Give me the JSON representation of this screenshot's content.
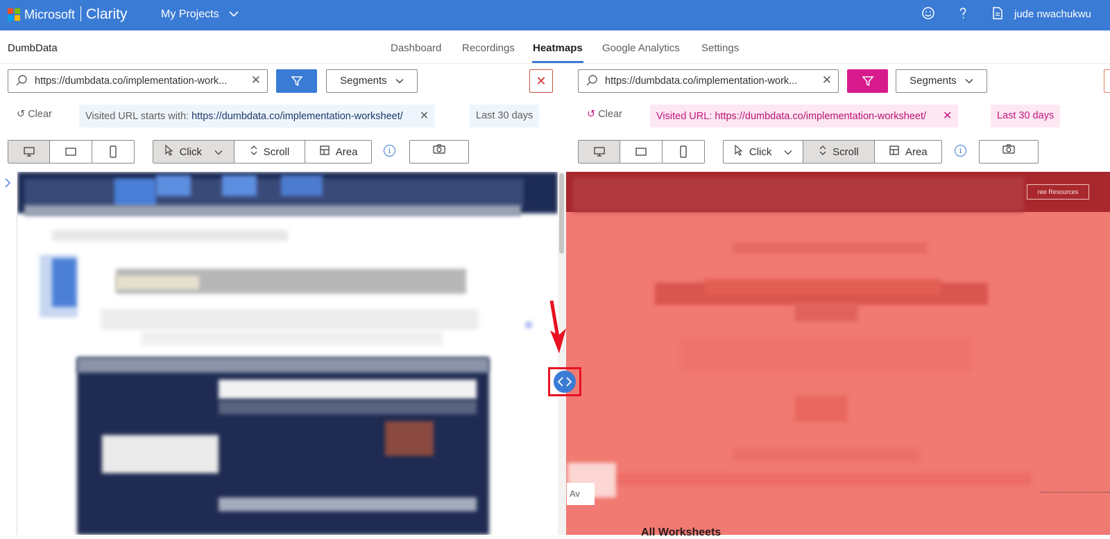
{
  "topbar": {
    "brand": "Microsoft",
    "product": "Clarity",
    "projects_label": "My Projects",
    "user_name": "jude nwachukwu"
  },
  "nav": {
    "project_name": "DumbData",
    "tabs": [
      {
        "label": "Dashboard"
      },
      {
        "label": "Recordings"
      },
      {
        "label": "Heatmaps"
      },
      {
        "label": "Google Analytics"
      },
      {
        "label": "Settings"
      }
    ],
    "active_tab": "Heatmaps"
  },
  "left": {
    "url_value": "https://dumbdata.co/implementation-work...",
    "segments_label": "Segments",
    "clear_label": "Clear",
    "filter_chip_prefix": "Visited URL starts with: ",
    "filter_chip_value": "https://dumbdata.co/implementation-worksheet/",
    "date_chip": "Last 30 days",
    "mode_click": "Click",
    "mode_scroll": "Scroll",
    "mode_area": "Area",
    "selected_mode": "Click",
    "filter_color": "#3a7bd5"
  },
  "right": {
    "url_value": "https://dumbdata.co/implementation-work...",
    "segments_label": "Segments",
    "clear_label": "Clear",
    "filter_chip_prefix": "Visited URL: ",
    "filter_chip_value": "https://dumbdata.co/implementation-worksheet/",
    "date_chip": "Last 30 days",
    "mode_click": "Click",
    "mode_scroll": "Scroll",
    "mode_area": "Area",
    "selected_mode": "Scroll",
    "filter_color": "#d81b8c"
  },
  "page_preview": {
    "av_label": "Av",
    "all_worksheets": "All Worksheets",
    "free_resources": "ree Resources"
  },
  "icons": {
    "feedback": "smiley-icon",
    "help": "question-icon",
    "docs": "document-icon"
  }
}
